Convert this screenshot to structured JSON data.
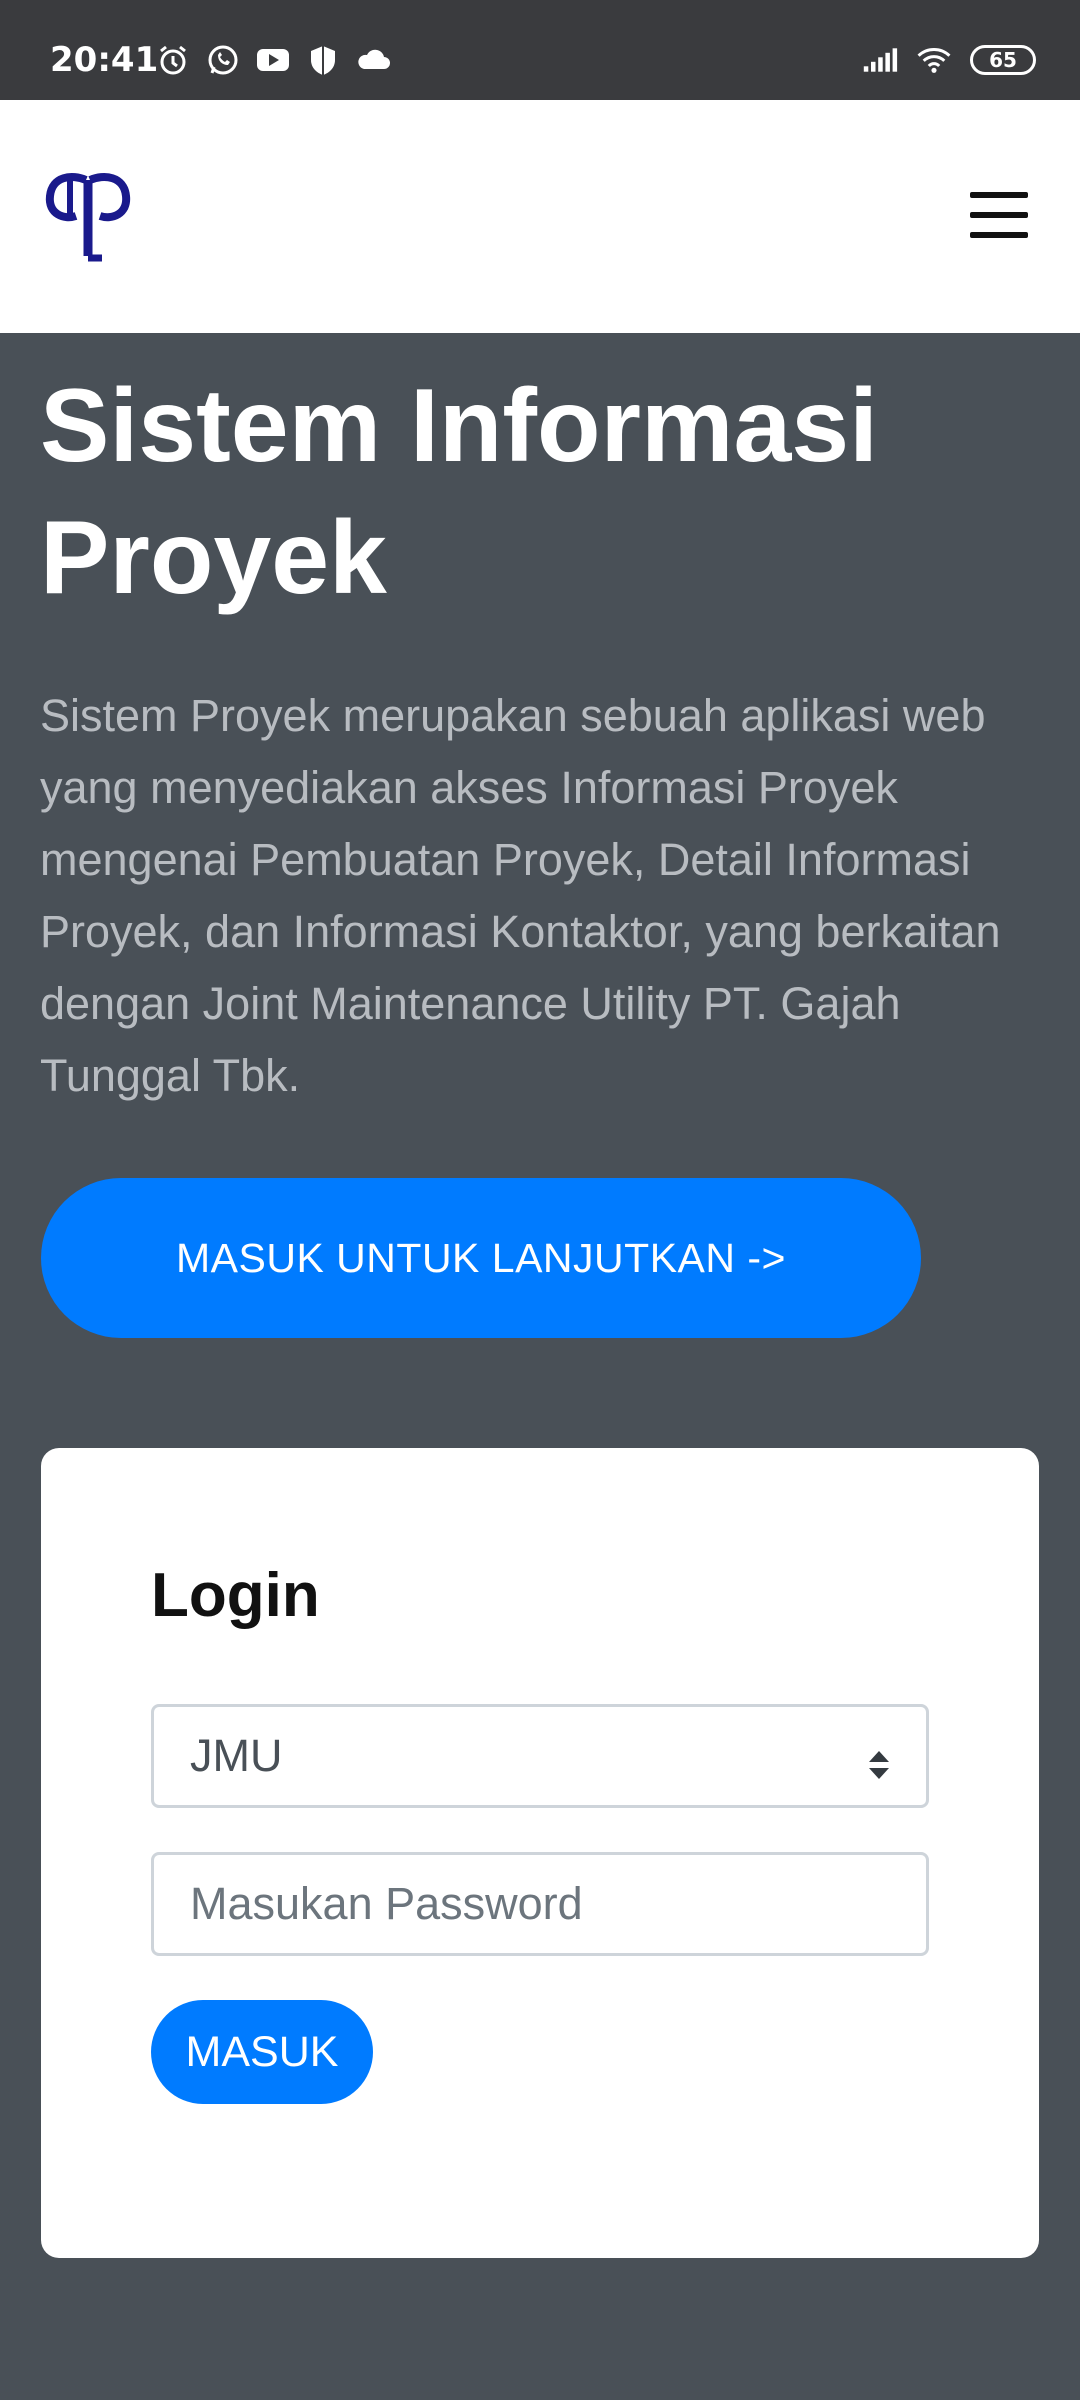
{
  "status_bar": {
    "time": "20:41",
    "battery": "65",
    "icons_left": [
      "alarm-icon",
      "whatsapp-icon",
      "youtube-icon",
      "shield-app-icon",
      "cloud-icon"
    ],
    "icons_right": [
      "signal-icon",
      "wifi-icon",
      "battery-icon"
    ]
  },
  "navbar": {
    "logo": "company-logo",
    "menu_icon": "hamburger-menu-icon"
  },
  "hero": {
    "title_line1": "Sistem Informasi",
    "title_line2": "Proyek",
    "description": "Sistem Proyek merupakan sebuah aplikasi web yang menyediakan akses Informasi Proyek mengenai Pembuatan Proyek, Detail Informasi Proyek, dan Informasi Kontaktor, yang berkaitan dengan Joint Maintenance Utility PT. Gajah Tunggal Tbk.",
    "cta_label": "MASUK UNTUK LANJUTKAN ->"
  },
  "login": {
    "title": "Login",
    "select_value": "JMU",
    "password_placeholder": "Masukan Password",
    "submit_label": "MASUK"
  },
  "colors": {
    "background": "#495057",
    "accent": "#007bff",
    "status_bar": "#3a3b3e",
    "logo": "#1a1a8c"
  }
}
